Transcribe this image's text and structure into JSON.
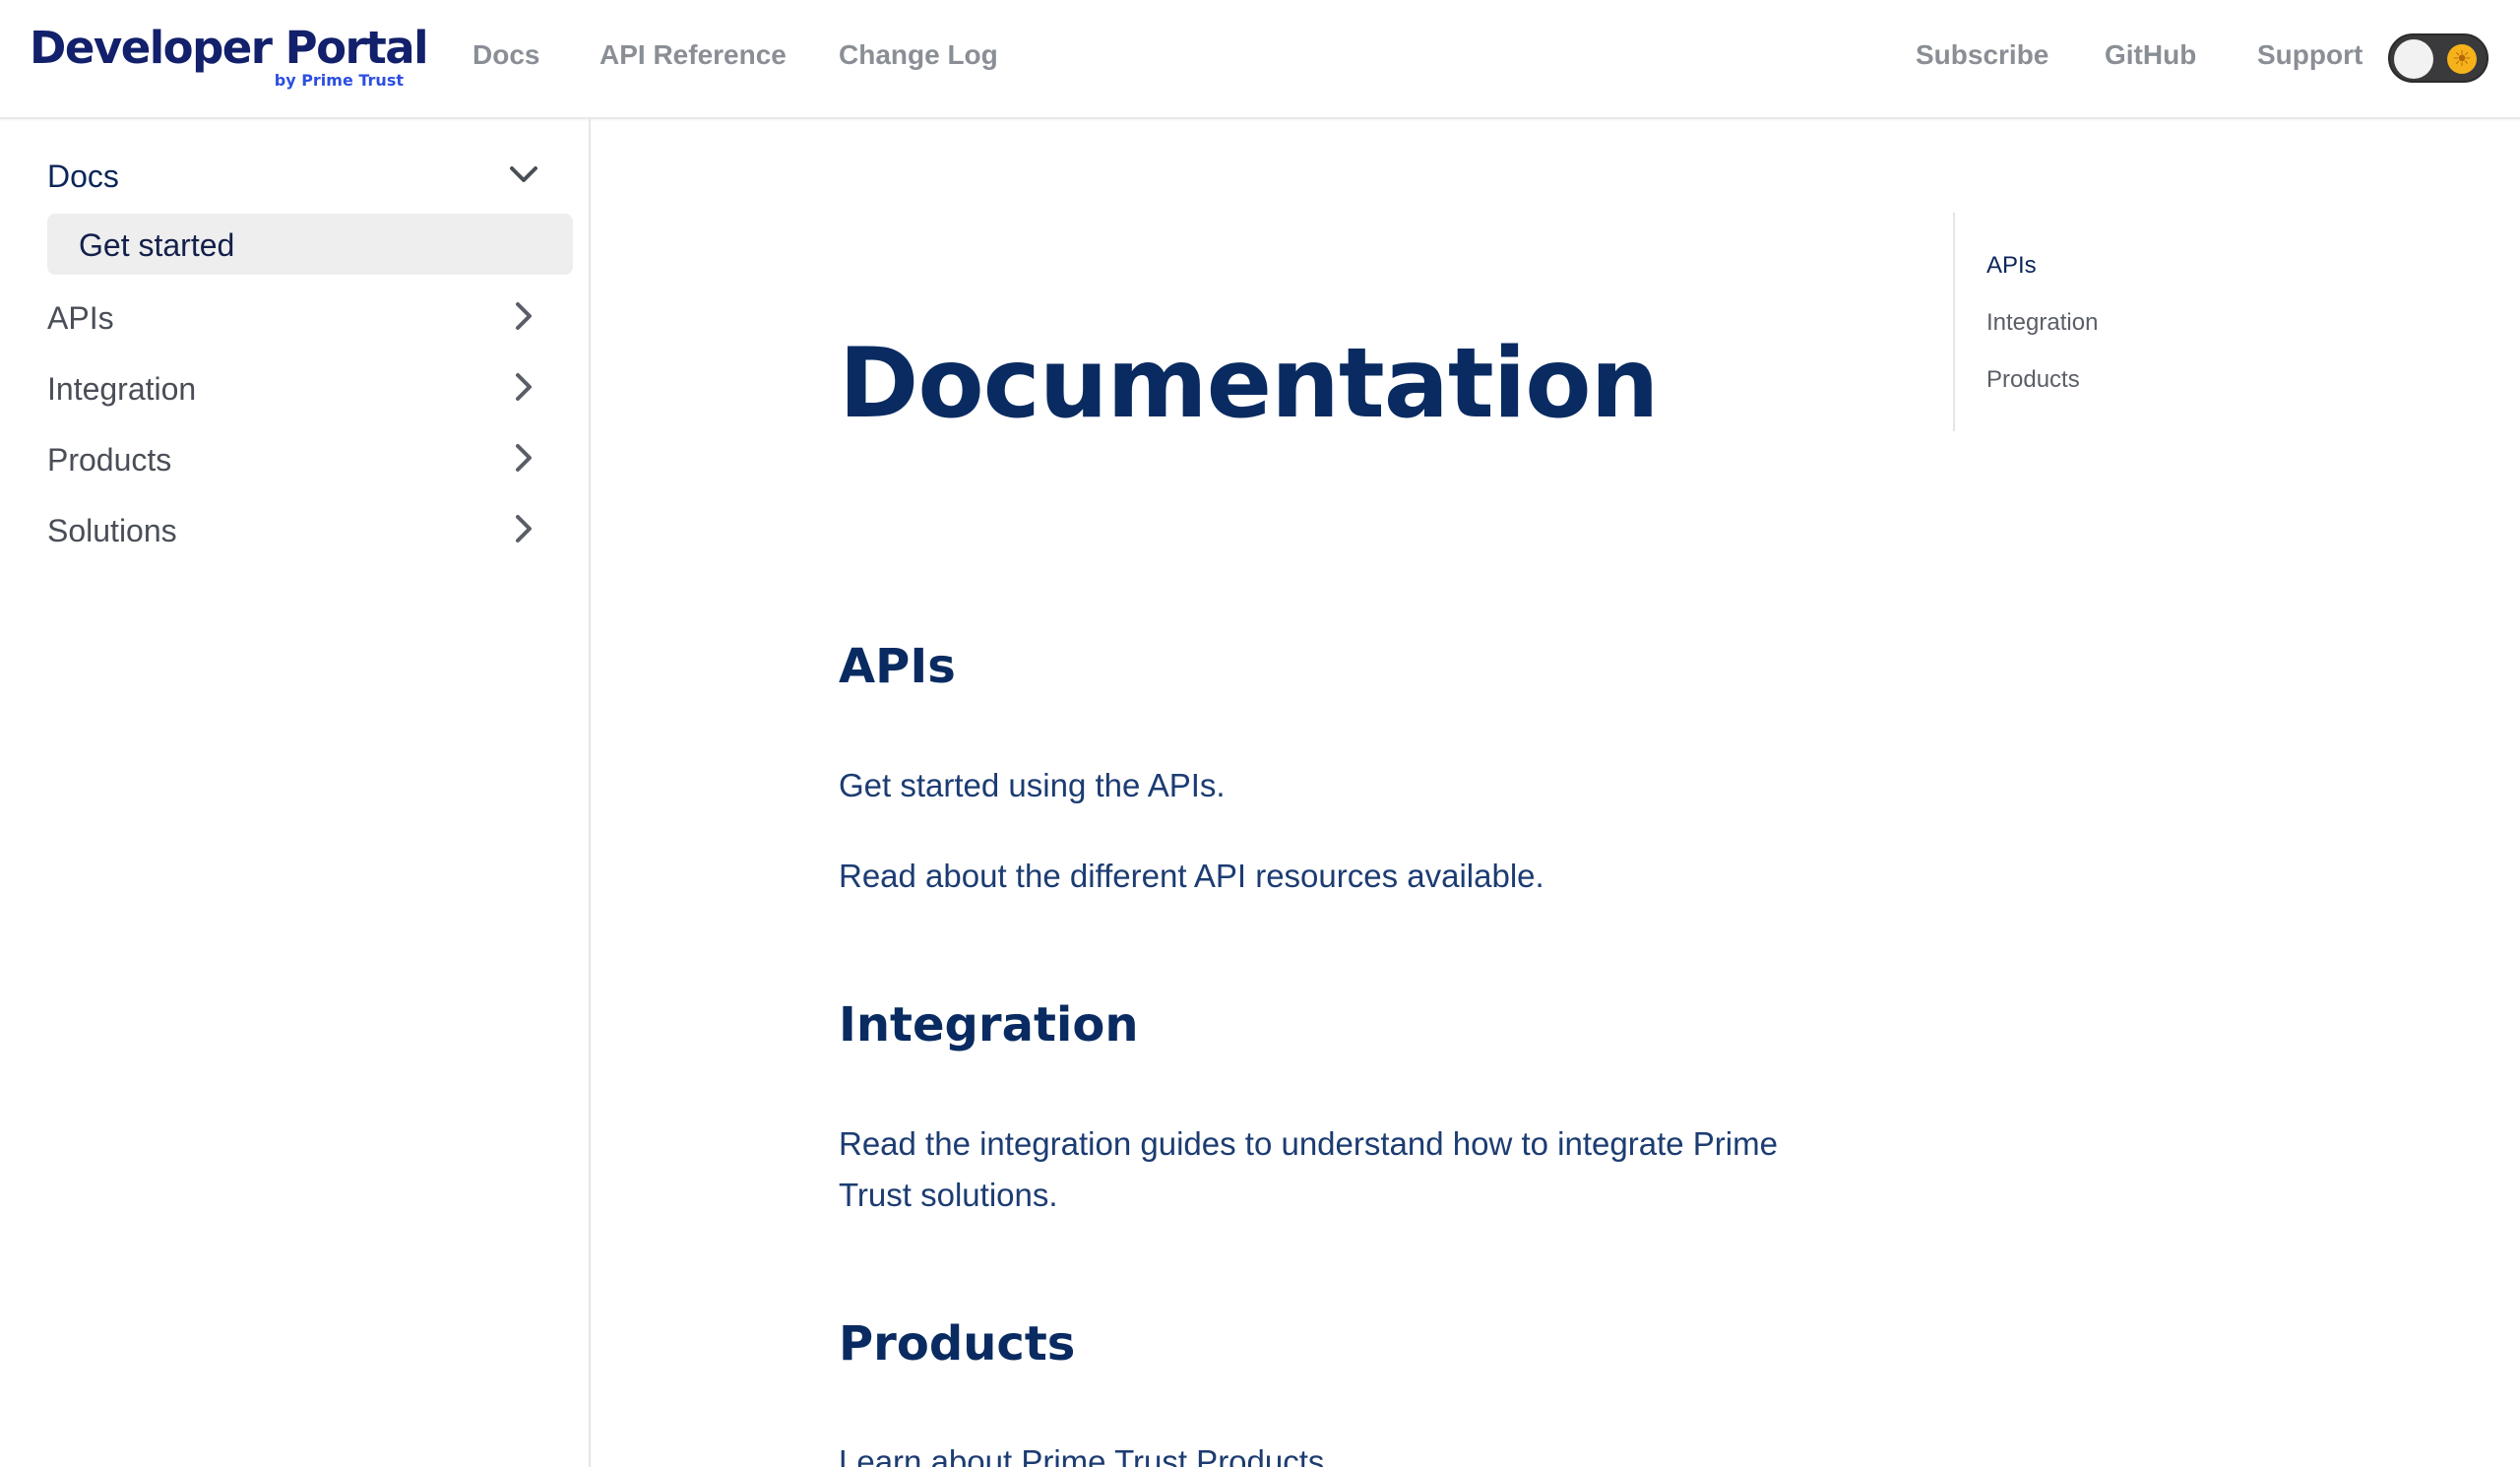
{
  "header": {
    "brand_title": "Developer Portal",
    "brand_subtitle": "by Prime Trust",
    "nav_left": [
      "Docs",
      "API Reference",
      "Change Log"
    ],
    "nav_right": [
      "Subscribe",
      "GitHub",
      "Support"
    ],
    "theme_toggle_icon": "sun-icon"
  },
  "sidebar": {
    "items": [
      {
        "label": "Docs",
        "expanded": true,
        "icon": "chevron-down-icon"
      },
      {
        "label": "APIs",
        "expanded": false,
        "icon": "chevron-right-icon"
      },
      {
        "label": "Integration",
        "expanded": false,
        "icon": "chevron-right-icon"
      },
      {
        "label": "Products",
        "expanded": false,
        "icon": "chevron-right-icon"
      },
      {
        "label": "Solutions",
        "expanded": false,
        "icon": "chevron-right-icon"
      }
    ],
    "active_subitem": "Get started"
  },
  "main": {
    "title": "Documentation",
    "sections": [
      {
        "heading": "APIs",
        "paragraphs": [
          "Get started using the APIs.",
          "Read about the different API resources available."
        ]
      },
      {
        "heading": "Integration",
        "paragraphs": [
          "Read the integration guides to understand how to integrate Prime Trust solutions."
        ]
      },
      {
        "heading": "Products",
        "paragraphs": [
          "Learn about Prime Trust Products"
        ]
      }
    ]
  },
  "toc": {
    "links": [
      "APIs",
      "Integration",
      "Products"
    ]
  },
  "colors": {
    "heading": "#092b61",
    "body_text": "#1c3c72",
    "nav_text": "#8a8e95",
    "brand": "#13206b",
    "brand_sub": "#2c4fe0",
    "active_sub_bg": "#eeeeee"
  }
}
